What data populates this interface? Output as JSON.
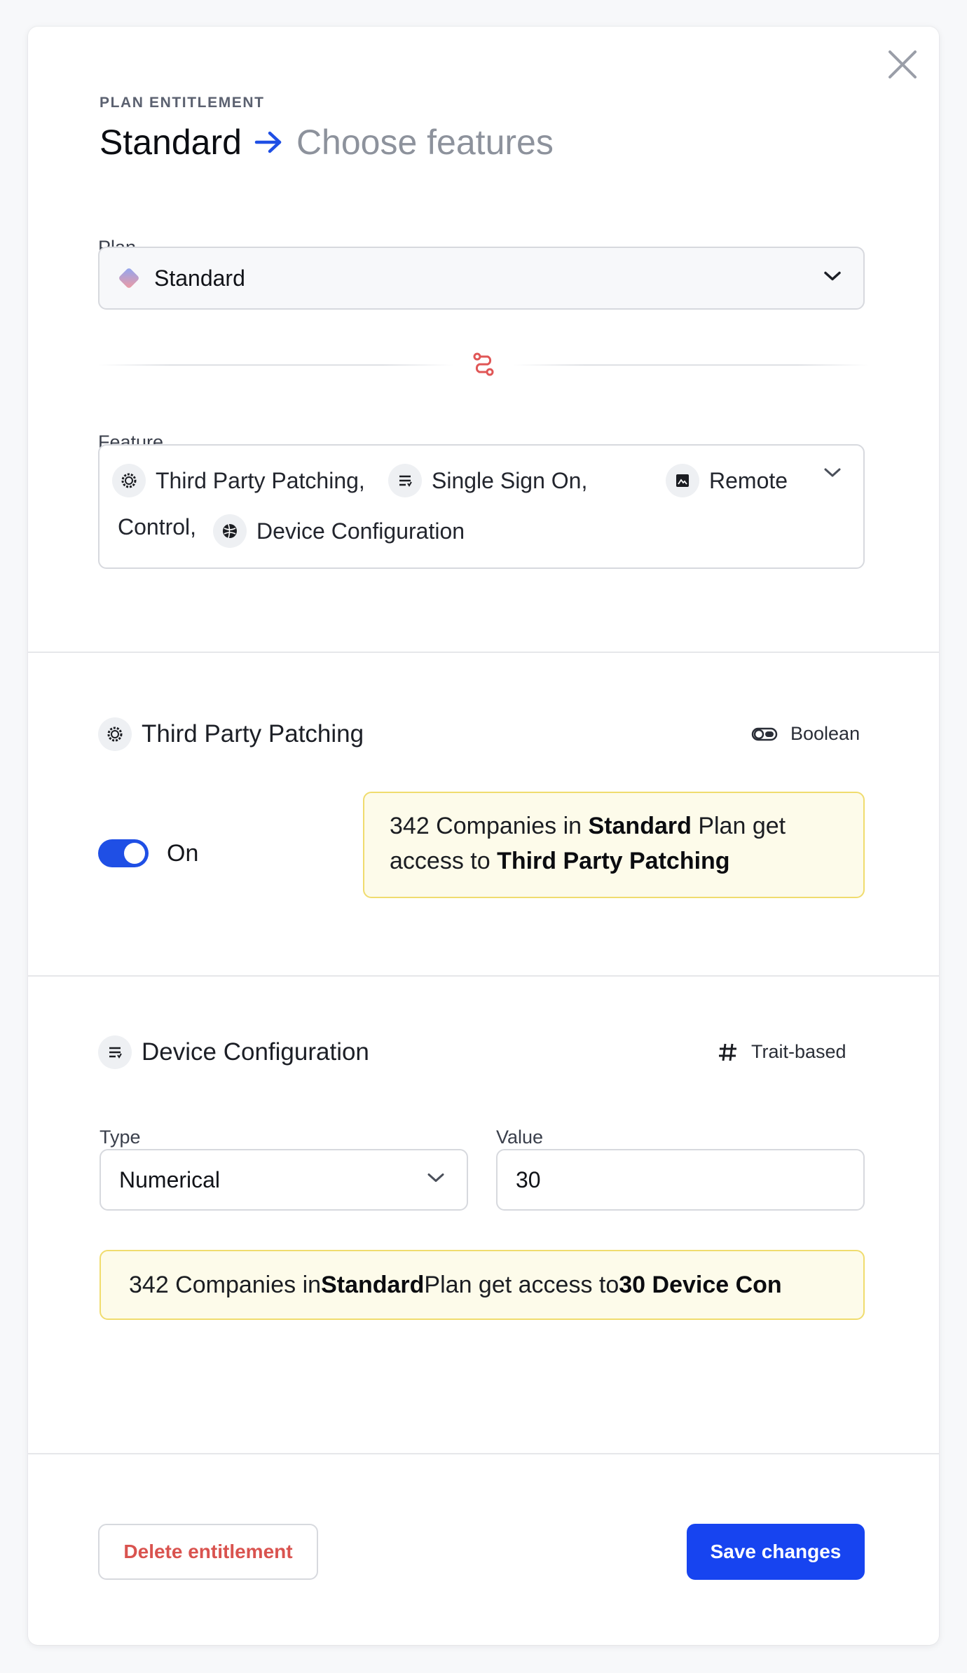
{
  "header": {
    "eyebrow": "PLAN ENTITLEMENT",
    "plan_name": "Standard",
    "step": "Choose features"
  },
  "plan_field": {
    "label": "Plan",
    "value": "Standard"
  },
  "feature_field": {
    "label": "Feature",
    "chips": [
      {
        "label": "Third Party Patching,",
        "icon": "gear-badge-icon"
      },
      {
        "label": "Single Sign On,",
        "icon": "list-icon"
      },
      {
        "label": "Remote",
        "icon": "image-icon"
      },
      {
        "label": "Control,",
        "icon": ""
      },
      {
        "label": "Device Configuration",
        "icon": "ball-icon"
      }
    ]
  },
  "boolean_section": {
    "title": "Third Party Patching",
    "type_label": "Boolean",
    "toggle_label": "On",
    "notice": {
      "count": "342 Companies in ",
      "plan": "Standard",
      "mid": " Plan get access to ",
      "feature": "Third Party Patching"
    }
  },
  "trait_section": {
    "title": "Device Configuration",
    "type_label": "Trait-based",
    "type_field_label": "Type",
    "type_value": "Numerical",
    "value_field_label": "Value",
    "value": "30",
    "notice": {
      "count": "342 Companies in ",
      "plan": "Standard",
      "mid": " Plan get access to ",
      "feature": "30 Device Con"
    }
  },
  "footer": {
    "delete_label": "Delete entitlement",
    "save_label": "Save changes"
  },
  "colors": {
    "accent": "#1744f0",
    "danger": "#d9534f",
    "notice_bg": "#fdfbea",
    "notice_border": "#f0dc6e"
  }
}
